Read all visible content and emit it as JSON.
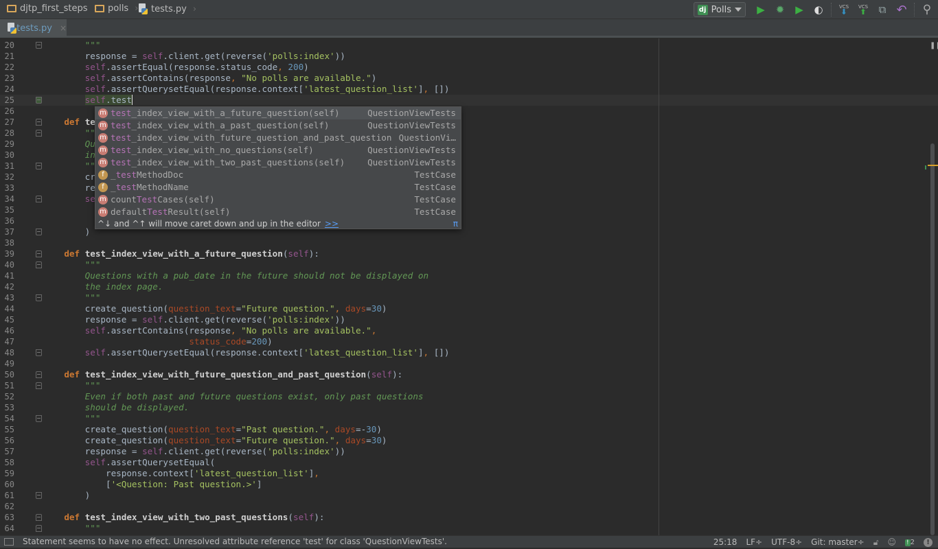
{
  "navbar": {
    "breadcrumbs": [
      {
        "label": "djtp_first_steps",
        "icon": "folder-icon"
      },
      {
        "label": "polls",
        "icon": "folder-icon"
      },
      {
        "label": "tests.py",
        "icon": "python-file-icon"
      }
    ],
    "run_config": {
      "badge": "dj",
      "label": "Polls"
    },
    "tools": [
      {
        "name": "run-icon",
        "glyph": "▶",
        "color": "#3cb043"
      },
      {
        "name": "debug-icon",
        "glyph": "✹",
        "color": "#59a869"
      },
      {
        "name": "coverage-icon",
        "glyph": "▶",
        "color": "#3cb043"
      },
      {
        "name": "profile-icon",
        "glyph": "◐",
        "color": "#dddddd"
      }
    ],
    "vcs_update": {
      "label": "VCS",
      "glyph": "⬇",
      "color": "#3592c4"
    },
    "vcs_commit": {
      "label": "VCS",
      "glyph": "⬆",
      "color": "#3cb043"
    },
    "history_glyph": "⧉",
    "revert_glyph": "↶",
    "search_glyph": "⚲"
  },
  "tab": {
    "label": "tests.py",
    "close": "×"
  },
  "editor": {
    "current_line": 25,
    "lines": [
      {
        "n": 20,
        "fold": "up",
        "t": [
          [
            "",
            "        "
          ],
          [
            "dq",
            "\"\"\""
          ]
        ]
      },
      {
        "n": 21,
        "t": [
          [
            "",
            "        response = "
          ],
          [
            "self",
            "self"
          ],
          [
            "",
            ".client.get(reverse("
          ],
          [
            "str",
            "'polls:index'"
          ],
          [
            "",
            "))"
          ]
        ]
      },
      {
        "n": 22,
        "t": [
          [
            "",
            "        "
          ],
          [
            "self",
            "self"
          ],
          [
            "",
            ".assertEqual(response.status_code"
          ],
          [
            "pun",
            ", "
          ],
          [
            "num",
            "200"
          ],
          [
            "",
            ")"
          ]
        ]
      },
      {
        "n": 23,
        "t": [
          [
            "",
            "        "
          ],
          [
            "self",
            "self"
          ],
          [
            "",
            ".assertContains(response"
          ],
          [
            "pun",
            ", "
          ],
          [
            "str",
            "\"No polls are available.\""
          ],
          [
            "",
            ")"
          ]
        ]
      },
      {
        "n": 24,
        "t": [
          [
            "",
            "        "
          ],
          [
            "self",
            "self"
          ],
          [
            "",
            ".assertQuerysetEqual(response.context["
          ],
          [
            "str",
            "'latest_question_list'"
          ],
          [
            "",
            "]"
          ],
          [
            "pun",
            ", "
          ],
          [
            "",
            "[])"
          ]
        ]
      },
      {
        "n": 25,
        "fold": "up",
        "t": [
          [
            "",
            "        "
          ],
          [
            "warn",
            "self"
          ],
          [
            "warnp",
            ".test"
          ],
          [
            "caret",
            ""
          ]
        ]
      },
      {
        "n": 26,
        "t": []
      },
      {
        "n": 27,
        "fold": "down",
        "t": [
          [
            "",
            "    "
          ],
          [
            "kw",
            "def "
          ],
          [
            "fnd",
            "te"
          ]
        ]
      },
      {
        "n": 28,
        "fold": "down",
        "t": [
          [
            "",
            "        "
          ],
          [
            "dq",
            "\"\""
          ]
        ]
      },
      {
        "n": 29,
        "t": [
          [
            "",
            "        "
          ],
          [
            "doc",
            "Qu"
          ]
        ]
      },
      {
        "n": 30,
        "t": [
          [
            "",
            "        "
          ],
          [
            "doc",
            "in"
          ]
        ]
      },
      {
        "n": 31,
        "fold": "up",
        "t": [
          [
            "",
            "        "
          ],
          [
            "dq",
            "\"\""
          ]
        ]
      },
      {
        "n": 32,
        "t": [
          [
            "",
            "        cr"
          ]
        ]
      },
      {
        "n": 33,
        "t": [
          [
            "",
            "        re"
          ]
        ]
      },
      {
        "n": 34,
        "fold": "down",
        "t": [
          [
            "",
            "        "
          ],
          [
            "self",
            "se"
          ]
        ]
      },
      {
        "n": 35,
        "t": []
      },
      {
        "n": 36,
        "t": []
      },
      {
        "n": 37,
        "fold": "up",
        "t": [
          [
            "",
            "        )"
          ]
        ]
      },
      {
        "n": 38,
        "t": []
      },
      {
        "n": 39,
        "fold": "down",
        "t": [
          [
            "",
            "    "
          ],
          [
            "kw",
            "def "
          ],
          [
            "fnd",
            "test_index_view_with_a_future_question"
          ],
          [
            "",
            "("
          ],
          [
            "self",
            "self"
          ],
          [
            "",
            "):"
          ]
        ]
      },
      {
        "n": 40,
        "fold": "down",
        "t": [
          [
            "",
            "        "
          ],
          [
            "dq",
            "\"\"\""
          ]
        ]
      },
      {
        "n": 41,
        "t": [
          [
            "",
            "        "
          ],
          [
            "doc",
            "Questions with a pub_date in the future should not be displayed on"
          ]
        ]
      },
      {
        "n": 42,
        "t": [
          [
            "",
            "        "
          ],
          [
            "doc",
            "the index page."
          ]
        ]
      },
      {
        "n": 43,
        "fold": "up",
        "t": [
          [
            "",
            "        "
          ],
          [
            "dq",
            "\"\"\""
          ]
        ]
      },
      {
        "n": 44,
        "t": [
          [
            "",
            "        create_question("
          ],
          [
            "param",
            "question_text"
          ],
          [
            "",
            "="
          ],
          [
            "str",
            "\"Future question.\""
          ],
          [
            "pun",
            ", "
          ],
          [
            "param",
            "days"
          ],
          [
            "",
            "="
          ],
          [
            "num",
            "30"
          ],
          [
            "",
            ")"
          ]
        ]
      },
      {
        "n": 45,
        "t": [
          [
            "",
            "        response = "
          ],
          [
            "self",
            "self"
          ],
          [
            "",
            ".client.get(reverse("
          ],
          [
            "str",
            "'polls:index'"
          ],
          [
            "",
            "))"
          ]
        ]
      },
      {
        "n": 46,
        "t": [
          [
            "",
            "        "
          ],
          [
            "self",
            "self"
          ],
          [
            "",
            ".assertContains(response"
          ],
          [
            "pun",
            ", "
          ],
          [
            "str",
            "\"No polls are available.\""
          ],
          [
            "pun",
            ","
          ]
        ]
      },
      {
        "n": 47,
        "t": [
          [
            "",
            "                            "
          ],
          [
            "param",
            "status_code"
          ],
          [
            "",
            "="
          ],
          [
            "num",
            "200"
          ],
          [
            "",
            ")"
          ]
        ]
      },
      {
        "n": 48,
        "fold": "up",
        "t": [
          [
            "",
            "        "
          ],
          [
            "self",
            "self"
          ],
          [
            "",
            ".assertQuerysetEqual(response.context["
          ],
          [
            "str",
            "'latest_question_list'"
          ],
          [
            "",
            "]"
          ],
          [
            "pun",
            ", "
          ],
          [
            "",
            "[])"
          ]
        ]
      },
      {
        "n": 49,
        "t": []
      },
      {
        "n": 50,
        "fold": "down",
        "t": [
          [
            "",
            "    "
          ],
          [
            "kw",
            "def "
          ],
          [
            "fnd",
            "test_index_view_with_future_question_and_past_question"
          ],
          [
            "",
            "("
          ],
          [
            "self",
            "self"
          ],
          [
            "",
            "):"
          ]
        ]
      },
      {
        "n": 51,
        "fold": "down",
        "t": [
          [
            "",
            "        "
          ],
          [
            "dq",
            "\"\"\""
          ]
        ]
      },
      {
        "n": 52,
        "t": [
          [
            "",
            "        "
          ],
          [
            "doc",
            "Even if both past and future questions exist, only past questions"
          ]
        ]
      },
      {
        "n": 53,
        "t": [
          [
            "",
            "        "
          ],
          [
            "doc",
            "should be displayed."
          ]
        ]
      },
      {
        "n": 54,
        "fold": "up",
        "t": [
          [
            "",
            "        "
          ],
          [
            "dq",
            "\"\"\""
          ]
        ]
      },
      {
        "n": 55,
        "t": [
          [
            "",
            "        create_question("
          ],
          [
            "param",
            "question_text"
          ],
          [
            "",
            "="
          ],
          [
            "str",
            "\"Past question.\""
          ],
          [
            "pun",
            ", "
          ],
          [
            "param",
            "days"
          ],
          [
            "",
            "=-"
          ],
          [
            "num",
            "30"
          ],
          [
            "",
            ")"
          ]
        ]
      },
      {
        "n": 56,
        "t": [
          [
            "",
            "        create_question("
          ],
          [
            "param",
            "question_text"
          ],
          [
            "",
            "="
          ],
          [
            "str",
            "\"Future question.\""
          ],
          [
            "pun",
            ", "
          ],
          [
            "param",
            "days"
          ],
          [
            "",
            "="
          ],
          [
            "num",
            "30"
          ],
          [
            "",
            ")"
          ]
        ]
      },
      {
        "n": 57,
        "t": [
          [
            "",
            "        response = "
          ],
          [
            "self",
            "self"
          ],
          [
            "",
            ".client.get(reverse("
          ],
          [
            "str",
            "'polls:index'"
          ],
          [
            "",
            "))"
          ]
        ]
      },
      {
        "n": 58,
        "t": [
          [
            "",
            "        "
          ],
          [
            "self",
            "self"
          ],
          [
            "",
            ".assertQuerysetEqual("
          ]
        ]
      },
      {
        "n": 59,
        "t": [
          [
            "",
            "            response.context["
          ],
          [
            "str",
            "'latest_question_list'"
          ],
          [
            "",
            "]"
          ],
          [
            "pun",
            ","
          ]
        ]
      },
      {
        "n": 60,
        "t": [
          [
            "",
            "            ["
          ],
          [
            "str",
            "'<Question: Past question.>'"
          ],
          [
            "",
            "]"
          ]
        ]
      },
      {
        "n": 61,
        "fold": "up",
        "t": [
          [
            "",
            "        )"
          ]
        ]
      },
      {
        "n": 62,
        "t": []
      },
      {
        "n": 63,
        "fold": "down",
        "t": [
          [
            "",
            "    "
          ],
          [
            "kw",
            "def "
          ],
          [
            "fnd",
            "test_index_view_with_two_past_questions"
          ],
          [
            "",
            "("
          ],
          [
            "self",
            "self"
          ],
          [
            "",
            "):"
          ]
        ]
      },
      {
        "n": 64,
        "fold": "down",
        "t": [
          [
            "",
            "        "
          ],
          [
            "dq",
            "\"\"\""
          ]
        ]
      }
    ]
  },
  "completion": {
    "items": [
      {
        "kind": "m",
        "match": "test",
        "rest": "_index_view_with_a_future_question",
        "args": "(self)",
        "type": "QuestionViewTests",
        "selected": true
      },
      {
        "kind": "m",
        "match": "test",
        "rest": "_index_view_with_a_past_question",
        "args": "(self)",
        "type": "QuestionViewTests"
      },
      {
        "kind": "m",
        "match": "test",
        "rest": "_index_view_with_future_question_and_past_question",
        "args": "",
        "type": "QuestionVi…"
      },
      {
        "kind": "m",
        "match": "test",
        "rest": "_index_view_with_no_questions",
        "args": "(self)",
        "type": "QuestionViewTests"
      },
      {
        "kind": "m",
        "match": "test",
        "rest": "_index_view_with_two_past_questions",
        "args": "(self)",
        "type": "QuestionViewTests"
      },
      {
        "kind": "f",
        "pre": "_",
        "match": "test",
        "rest": "MethodDoc",
        "args": "",
        "type": "TestCase"
      },
      {
        "kind": "f",
        "pre": "_",
        "match": "test",
        "rest": "MethodName",
        "args": "",
        "type": "TestCase"
      },
      {
        "kind": "m",
        "pre": "count",
        "match": "Test",
        "rest": "Cases",
        "args": "(self)",
        "type": "TestCase"
      },
      {
        "kind": "m",
        "pre": "default",
        "match": "Test",
        "rest": "Result",
        "args": "(self)",
        "type": "TestCase"
      }
    ],
    "footer": "^↓ and ^↑ will move caret down and up in the editor",
    "footer_link": ">>",
    "footer_pi": "π"
  },
  "status": {
    "message": "Statement seems to have no effect. Unresolved attribute reference 'test' for class 'QuestionViewTests'.",
    "position": "25:18",
    "line_sep": "LF÷",
    "encoding": "UTF-8÷",
    "vcs": "Git: master÷",
    "events": "2",
    "warning": "!"
  }
}
